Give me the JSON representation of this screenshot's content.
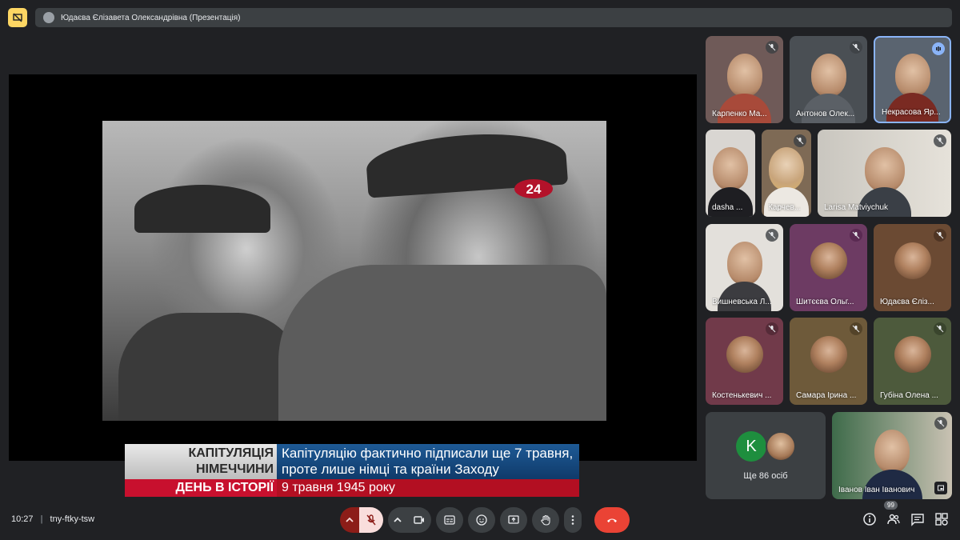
{
  "presentation": {
    "title": "Юдаєва Єлізавета Олександрівна (Презентація)"
  },
  "video": {
    "channel_logo": "24",
    "lower_third": {
      "label_line1": "КАПІТУЛЯЦІЯ",
      "label_line2": "НІМЕЧЧИНИ",
      "text": "Капітуляцію фактично підписали ще 7 травня, проте лише німці та країни Заходу",
      "section": "ДЕНЬ В ІСТОРІЇ",
      "date": "9 травня 1945 року"
    }
  },
  "participants": [
    {
      "name": "Карпенко Ма..."
    },
    {
      "name": "Антонов Олек..."
    },
    {
      "name": "Некрасова Яр..."
    },
    {
      "name": "dasha ..."
    },
    {
      "name": "Карчев..."
    },
    {
      "name": "Larisa Matviychuk"
    },
    {
      "name": "Вишневська Л..."
    },
    {
      "name": "Шитєєва Ольг..."
    },
    {
      "name": "Юдаєва Єліз..."
    },
    {
      "name": "Костенькевич ..."
    },
    {
      "name": "Самара Ірина ..."
    },
    {
      "name": "Губіна Олена ..."
    },
    {
      "name": "Іванов Іван Іванович"
    }
  ],
  "more_tile": {
    "initial": "K",
    "label": "Ще 86 осіб"
  },
  "bottom": {
    "time": "10:27",
    "separator": "|",
    "meeting_code": "tny-ftky-tsw",
    "people_count": "99"
  },
  "colors": {
    "accent": "#8ab4f8",
    "hangup": "#ea4335",
    "present_badge": "#fdd663"
  }
}
